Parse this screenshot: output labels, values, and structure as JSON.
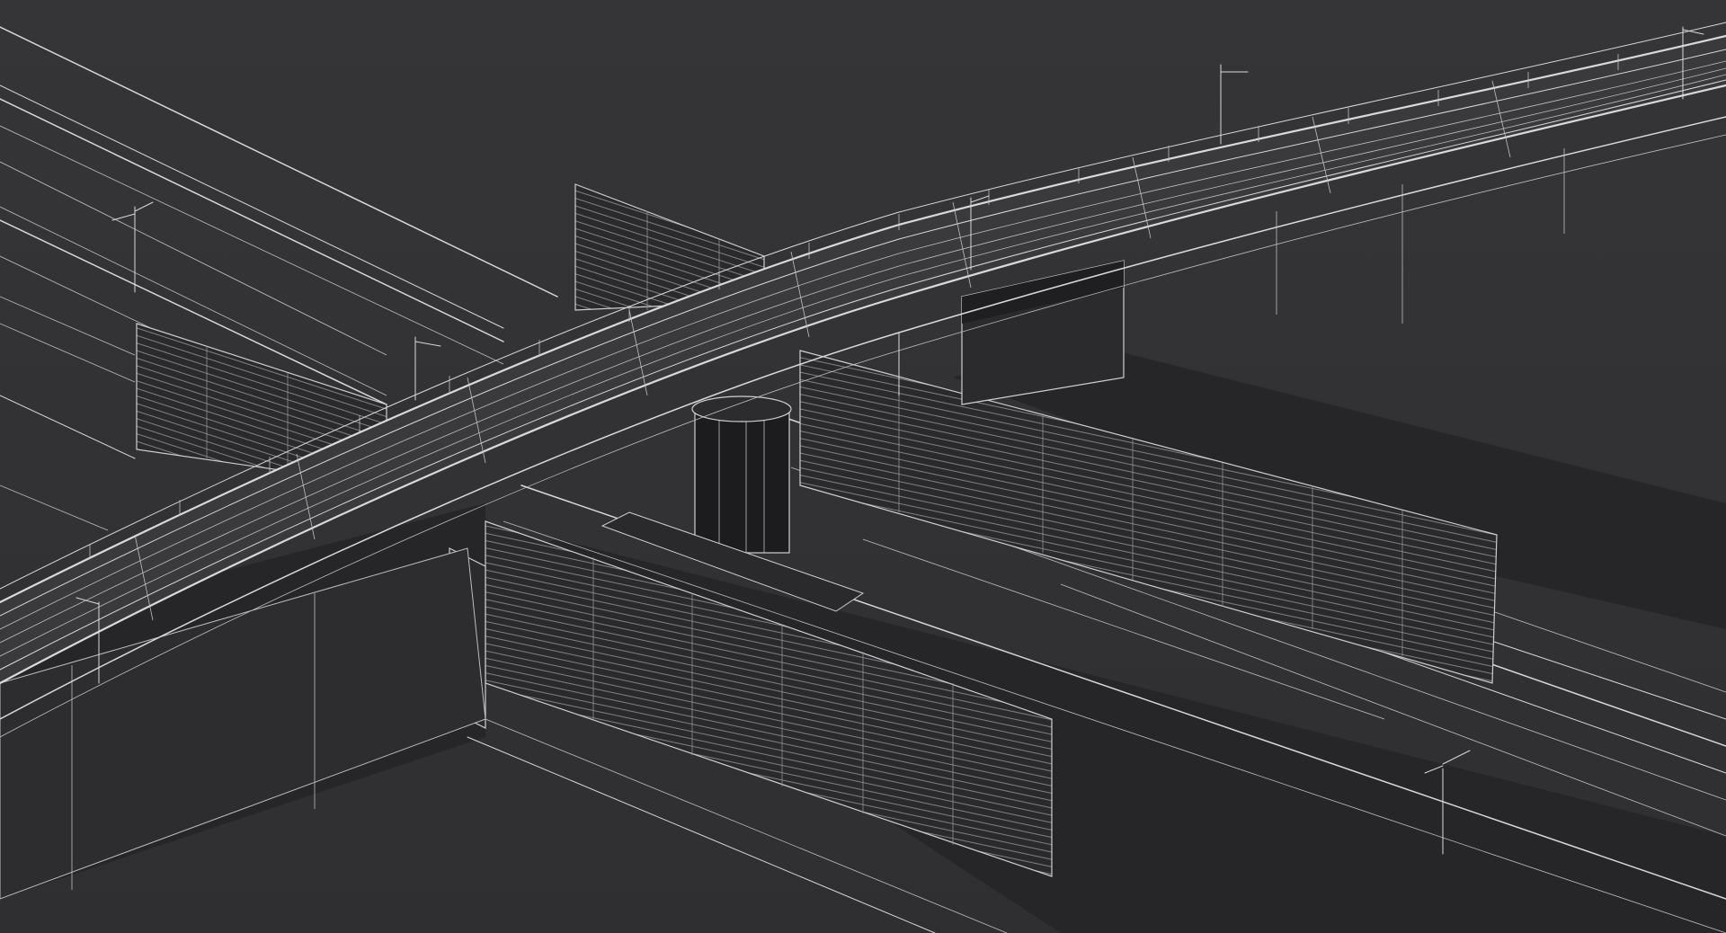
{
  "scene": {
    "background": "#333335",
    "wire_color": "#d9d9dc",
    "shadow_color": "#262628",
    "deck_color": "#3a3a3d"
  }
}
